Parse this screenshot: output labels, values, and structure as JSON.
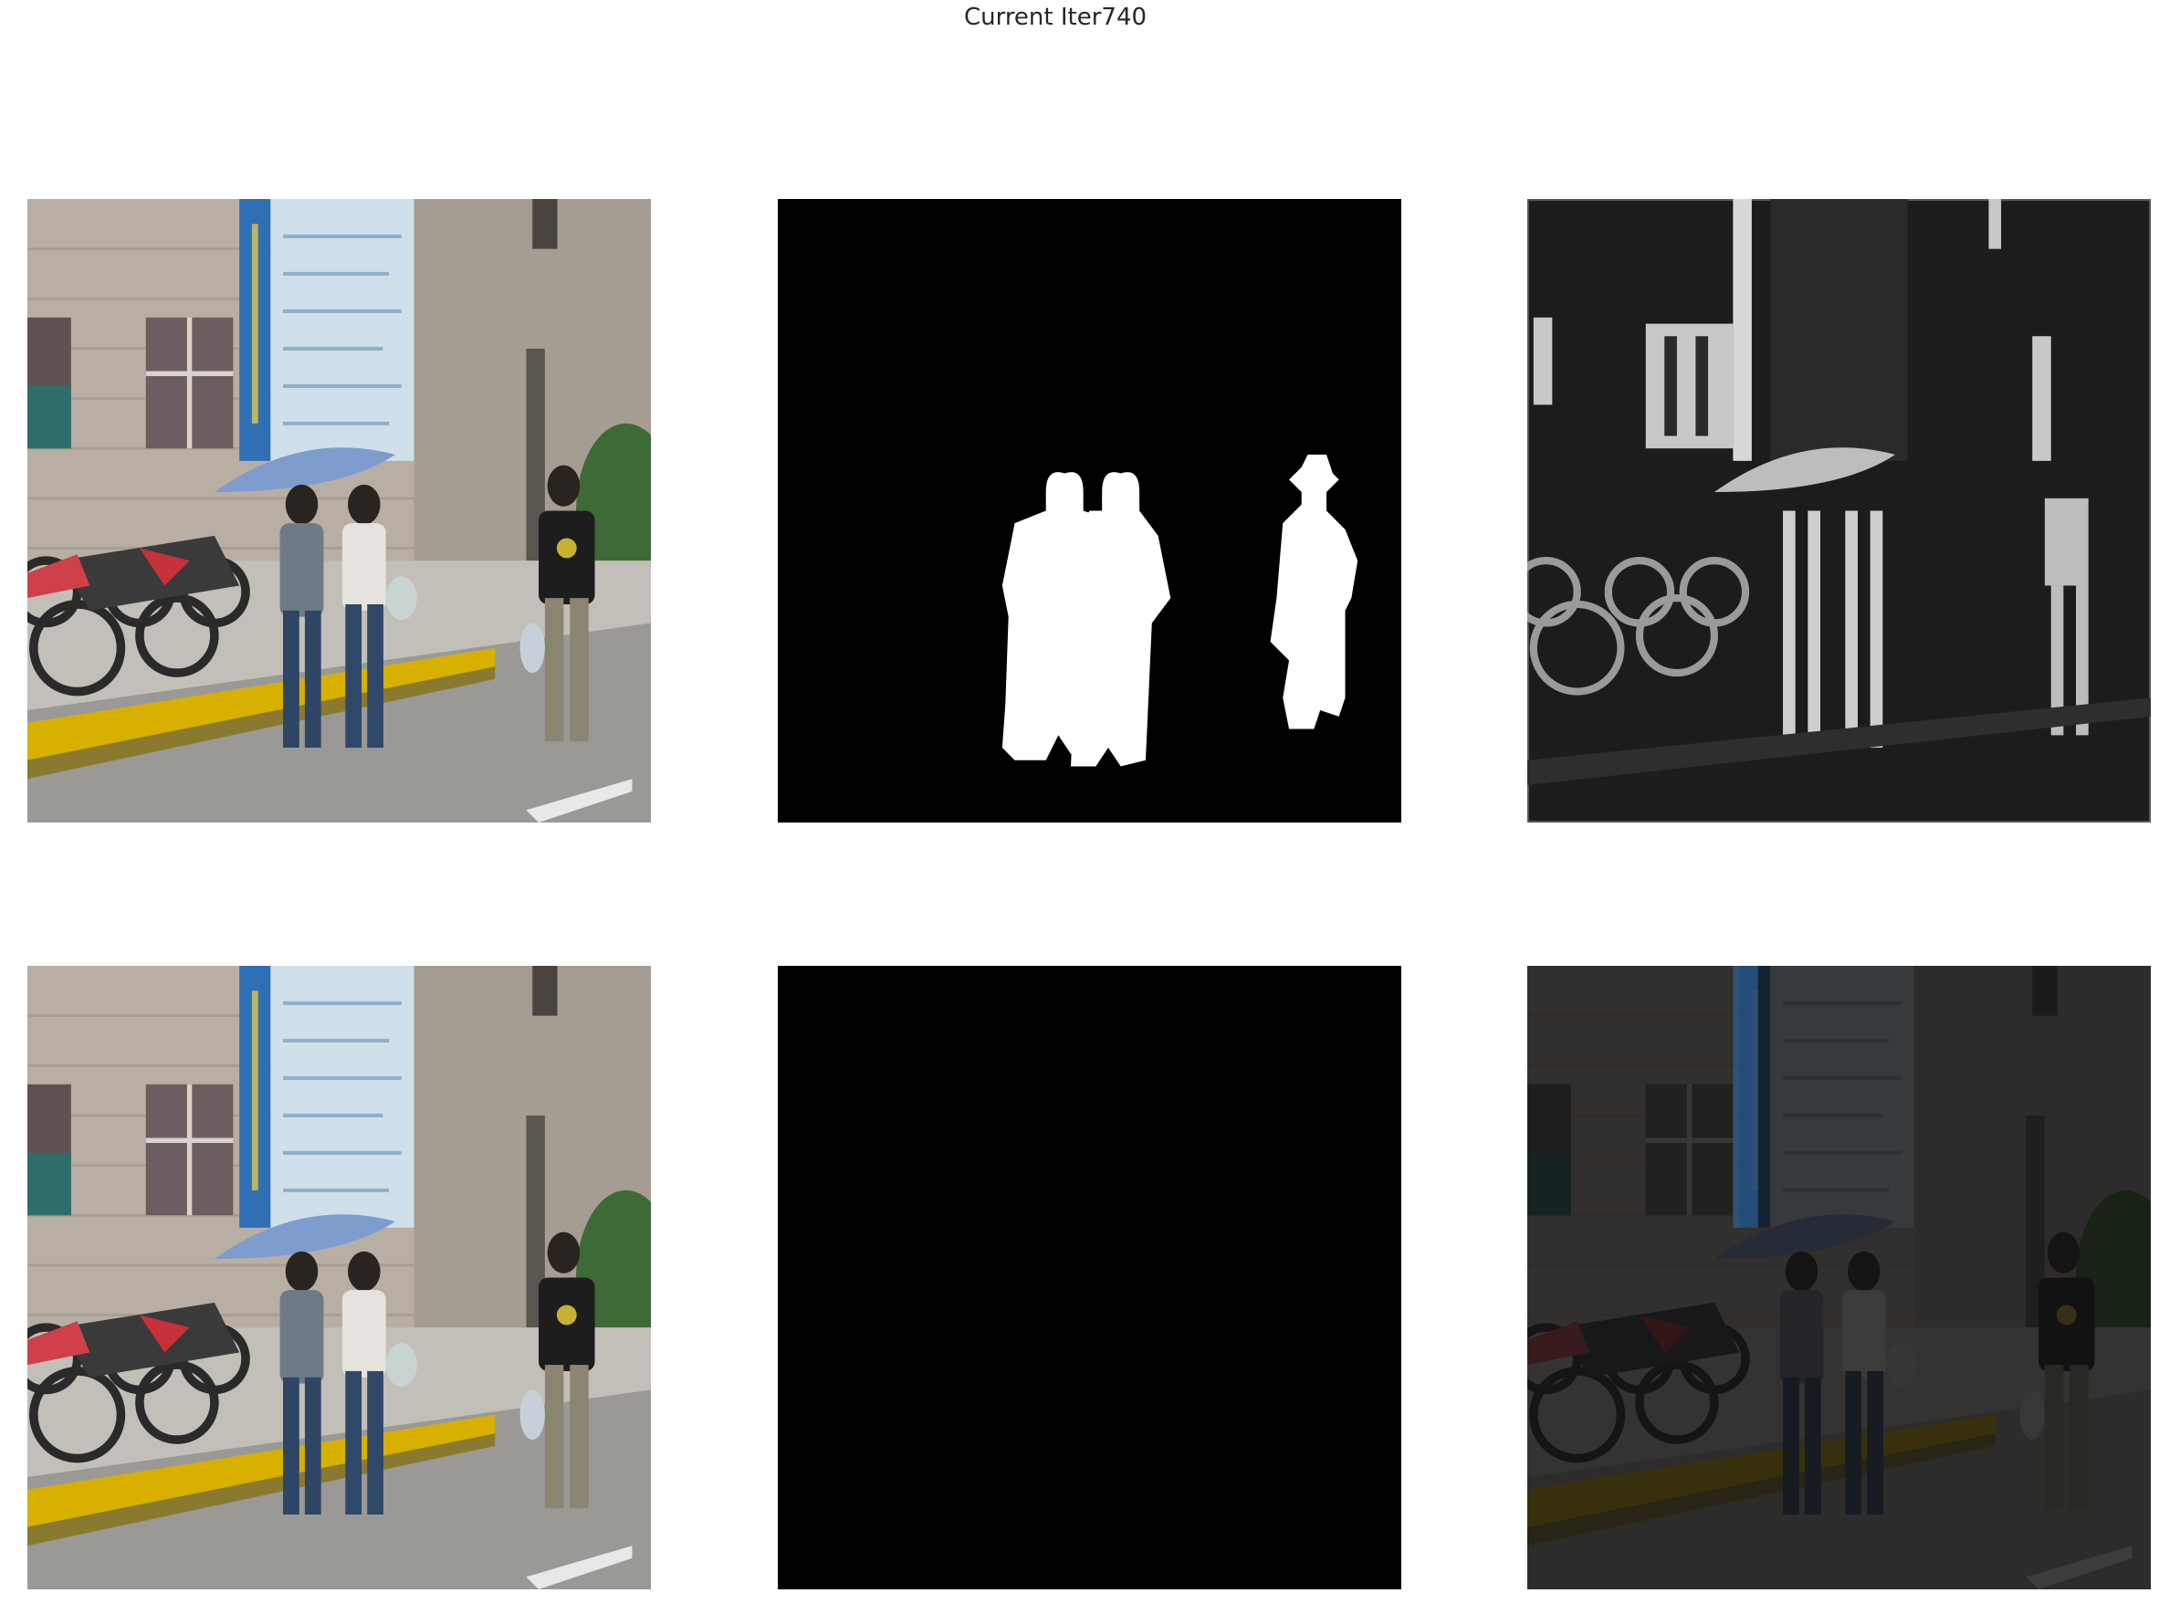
{
  "figure": {
    "title": "Current Iter740"
  },
  "panels": [
    {
      "row": 1,
      "col": 1,
      "content": "input-photo"
    },
    {
      "row": 1,
      "col": 2,
      "content": "binary-mask"
    },
    {
      "row": 1,
      "col": 3,
      "content": "grayscale-saliency"
    },
    {
      "row": 2,
      "col": 1,
      "content": "input-photo"
    },
    {
      "row": 2,
      "col": 2,
      "content": "masked-foreground"
    },
    {
      "row": 2,
      "col": 3,
      "content": "dimmed-residual"
    }
  ],
  "colors": {
    "background": "#ffffff",
    "title_text": "#262626",
    "mask_bg": "#000000",
    "mask_fg": "#ffffff",
    "sign_blue": "#2f6fb5",
    "umbrella": "#7f9ccf"
  }
}
